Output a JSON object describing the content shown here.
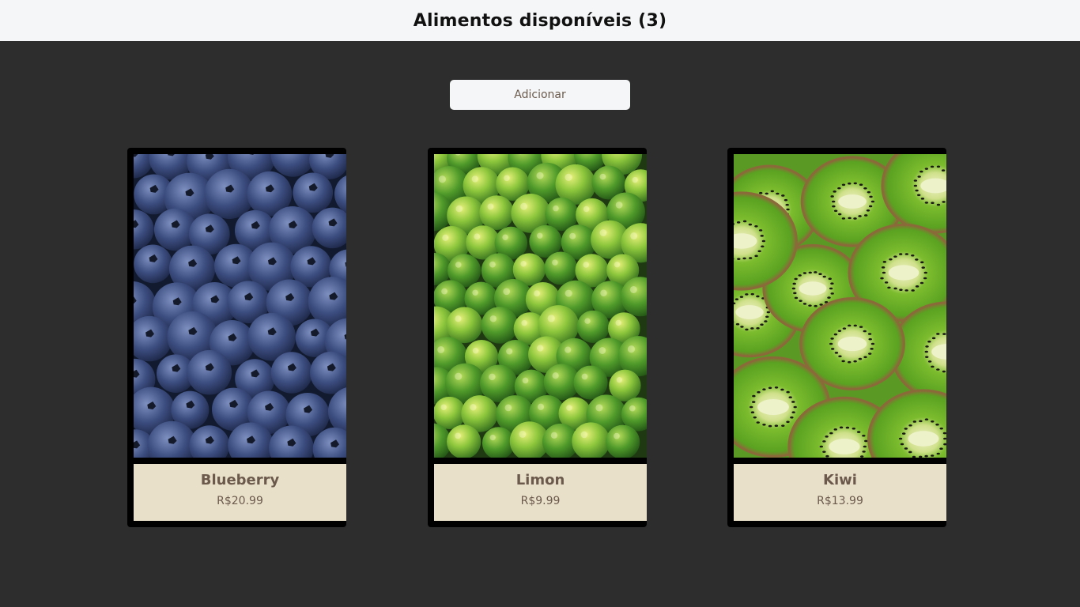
{
  "header": {
    "title": "Alimentos disponíveis (3)"
  },
  "toolbar": {
    "add_label": "Adicionar"
  },
  "colors": {
    "page_bg": "#2d2d2d",
    "header_bg": "#f5f6f8",
    "card_info_bg": "#e9e0c9",
    "text_brown": "#6b5a4c"
  },
  "products": [
    {
      "name": "Blueberry",
      "price": "R$20.99",
      "image": "blueberries-photo"
    },
    {
      "name": "Limon",
      "price": "R$9.99",
      "image": "limes-photo"
    },
    {
      "name": "Kiwi",
      "price": "R$13.99",
      "image": "kiwi-slices-photo"
    }
  ]
}
